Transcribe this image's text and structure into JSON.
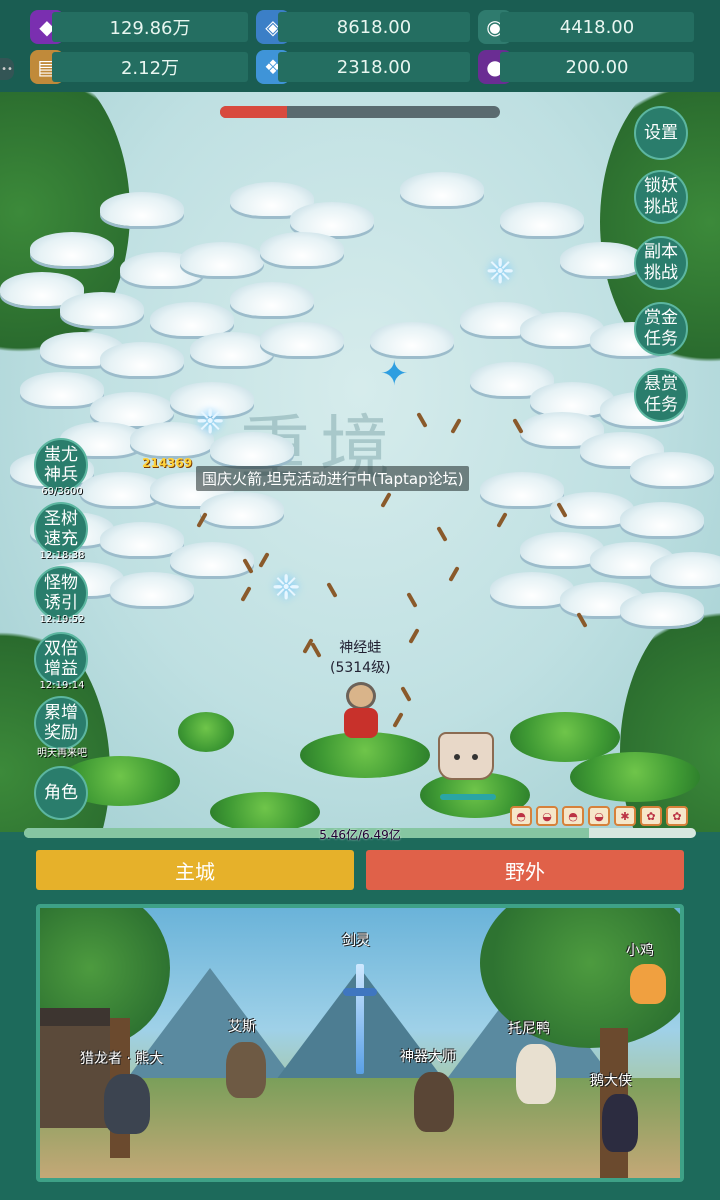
{
  "resources": [
    {
      "icon": "purple-gem-icon",
      "value": "129.86万",
      "color": "#a04fd8"
    },
    {
      "icon": "blue-crystal-icon",
      "value": "8618.00",
      "color": "#4a9fe0"
    },
    {
      "icon": "green-orb-icon",
      "value": "4418.00",
      "color": "#3c9a8a"
    },
    {
      "icon": "scroll-icon",
      "value": "2.12万",
      "color": "#d8a85a"
    },
    {
      "icon": "ice-cube-icon",
      "value": "2318.00",
      "color": "#5ab5f0"
    },
    {
      "icon": "purple-pouch-icon",
      "value": "200.00",
      "color": "#7a3fa8"
    }
  ],
  "field": {
    "boss_hp_fraction": 0.24,
    "watermark": "重境",
    "announcement": "国庆火箭,坦克活动进行中(Taptap论坛)",
    "damage_number": "214369",
    "player_name": "神经蛙",
    "player_level": "(5314级)"
  },
  "left_buttons": [
    {
      "label": "蚩尤\n神兵",
      "sub": "69/3600"
    },
    {
      "label": "圣树\n速充",
      "sub": "12:18:38"
    },
    {
      "label": "怪物\n诱引",
      "sub": "12:19:52"
    },
    {
      "label": "双倍\n增益",
      "sub": "12:19:14"
    },
    {
      "label": "累增\n奖励",
      "sub": "明天再来吧"
    },
    {
      "label": "角色",
      "sub": ""
    }
  ],
  "right_buttons": [
    "设置",
    "锁妖\n挑战",
    "副本\n挑战",
    "赏金\n任务",
    "悬赏\n任务"
  ],
  "xp": {
    "text": "5.46亿/6.49亿",
    "fraction": 0.841
  },
  "tabs": {
    "main_city": "主城",
    "wild": "野外"
  },
  "npcs": {
    "sword_spirit": "剑灵",
    "chick": "小鸡",
    "ais": "艾斯",
    "tony_duck": "托尼鸭",
    "dragon_hunter": "猎龙者 · 熊大",
    "artifact_master": "神器大师",
    "goose_hero": "鹅大侠"
  },
  "colors": {
    "main_city_tab": "#e6b12a",
    "wild_tab": "#e06149",
    "panel_teal": "#1d6a5b"
  }
}
